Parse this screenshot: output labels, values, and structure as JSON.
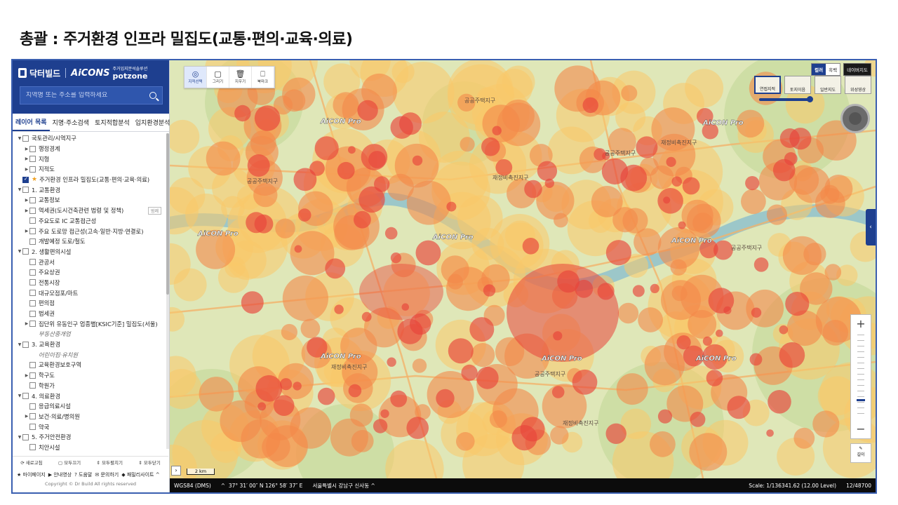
{
  "slide": {
    "title": "총괄 : 주거환경 인프라 밀집도(교통·편의·교육·의료)"
  },
  "sidebar": {
    "logo": {
      "brand": "닥터빌드",
      "aicon": "AiCONS",
      "spot": "potzone",
      "spot_sub": "주거입지분석솔루션"
    },
    "search": {
      "placeholder": "지역명 또는 주소를 입력하세요"
    },
    "tabs": [
      "레이어 목록",
      "지명·주소검색",
      "토지적합분석",
      "입지환경분석"
    ],
    "tree": [
      {
        "level": 0,
        "arrow": "▼",
        "check": "none",
        "label": "국토관리/시역지구"
      },
      {
        "level": 1,
        "arrow": "▶",
        "check": "none",
        "label": "행정경계"
      },
      {
        "level": 1,
        "arrow": "▶",
        "check": "none",
        "label": "지형"
      },
      {
        "level": 1,
        "arrow": "▶",
        "check": "none",
        "label": "지적도"
      },
      {
        "level": 0,
        "arrow": "",
        "check": "checked",
        "star": true,
        "label": "주거환경 인프라 밀집도(교통·편의·교육·의료)"
      },
      {
        "level": 0,
        "arrow": "▼",
        "check": "none",
        "label": "1. 교통환경"
      },
      {
        "level": 1,
        "arrow": "▶",
        "check": "none",
        "label": "교통정보"
      },
      {
        "level": 1,
        "arrow": "▶",
        "check": "none",
        "label": "역세권(도시건축관련 법령 및 정책)",
        "legend": "범례"
      },
      {
        "level": 1,
        "arrow": "",
        "check": "none",
        "label": "주요도로 IC 교통접근성"
      },
      {
        "level": 1,
        "arrow": "▶",
        "check": "none",
        "label": "주요 도로망 접근성(고속·일반·지방·연결로)"
      },
      {
        "level": 1,
        "arrow": "",
        "check": "none",
        "label": "개발예정 도로/철도"
      },
      {
        "level": 0,
        "arrow": "▼",
        "check": "none",
        "label": "2. 생활편의시설"
      },
      {
        "level": 1,
        "arrow": "",
        "check": "none",
        "label": "관공서"
      },
      {
        "level": 1,
        "arrow": "",
        "check": "none",
        "label": "주요상권"
      },
      {
        "level": 1,
        "arrow": "",
        "check": "none",
        "label": "전통시장"
      },
      {
        "level": 1,
        "arrow": "",
        "check": "none",
        "label": "대규모점포/마트"
      },
      {
        "level": 1,
        "arrow": "",
        "check": "none",
        "label": "편의점"
      },
      {
        "level": 1,
        "arrow": "",
        "check": "none",
        "label": "법세권"
      },
      {
        "level": 1,
        "arrow": "▶",
        "check": "none",
        "label": "집단위 유동인구 업종별[KSIC기준] 밀집도(서울)"
      },
      {
        "level": 1,
        "arrow": "",
        "check": "hidden",
        "label": "부동산중개업",
        "muted": true
      },
      {
        "level": 0,
        "arrow": "▼",
        "check": "none",
        "label": "3. 교육환경"
      },
      {
        "level": 1,
        "arrow": "",
        "check": "hidden",
        "label": "어린이집·유치원",
        "muted": true
      },
      {
        "level": 1,
        "arrow": "",
        "check": "none",
        "label": "교육환경보호구역"
      },
      {
        "level": 1,
        "arrow": "▶",
        "check": "none",
        "label": "학구도"
      },
      {
        "level": 1,
        "arrow": "",
        "check": "none",
        "label": "학원가"
      },
      {
        "level": 0,
        "arrow": "▼",
        "check": "none",
        "label": "4. 의료환경"
      },
      {
        "level": 1,
        "arrow": "",
        "check": "none",
        "label": "응급의료시설"
      },
      {
        "level": 1,
        "arrow": "▶",
        "check": "none",
        "label": "보건·의료/병의원"
      },
      {
        "level": 1,
        "arrow": "",
        "check": "none",
        "label": "약국"
      },
      {
        "level": 0,
        "arrow": "▼",
        "check": "none",
        "label": "5. 주거안전환경"
      },
      {
        "level": 1,
        "arrow": "",
        "check": "none",
        "label": "치안시설"
      }
    ],
    "tree_tools": [
      "새로고침",
      "모두끄기",
      "모두펼치기",
      "모두닫기"
    ],
    "footer_links": [
      "마이페이지",
      "안내영상",
      "도움말",
      "문의하기",
      "패밀리사이트"
    ],
    "copyright": "Copyright © Dr Build All rights reserved"
  },
  "map": {
    "toolbar": [
      {
        "icon": "target-icon",
        "glyph": "◎",
        "label": "지적선택"
      },
      {
        "icon": "draw-icon",
        "glyph": "▢",
        "label": "그리기"
      },
      {
        "icon": "trash-icon",
        "glyph": "🗑",
        "label": "지우기"
      },
      {
        "icon": "bookmark-icon",
        "glyph": "⎕",
        "label": "북마크"
      }
    ],
    "maptype": {
      "color": "컬러",
      "gray": "흑백",
      "naver": "네이버지도"
    },
    "layers": [
      "연접지적",
      "토지이음",
      "일반지도",
      "위성영상"
    ],
    "zoom": {
      "plus": "+",
      "minus": "−"
    },
    "ruler_label": "길이",
    "scalebar": "2 km",
    "map_labels": [
      "재정비촉진지구",
      "공공주택지구",
      "AiCON Pro"
    ],
    "colors": {
      "heat_core": "#e8443a",
      "heat_mid": "#f4894a",
      "heat_low": "#f9c96a",
      "base": "#dfe7b8",
      "river": "#9cc7c9"
    }
  },
  "status": {
    "crs": "WGS84 (DMS)",
    "coords": "37° 31′ 00″ N 126° 58′ 37″ E",
    "address": "서울특별시 강남구 신사동",
    "scale": "Scale: 1/136341.62 (12.00 Level)",
    "count": "12/48700"
  }
}
